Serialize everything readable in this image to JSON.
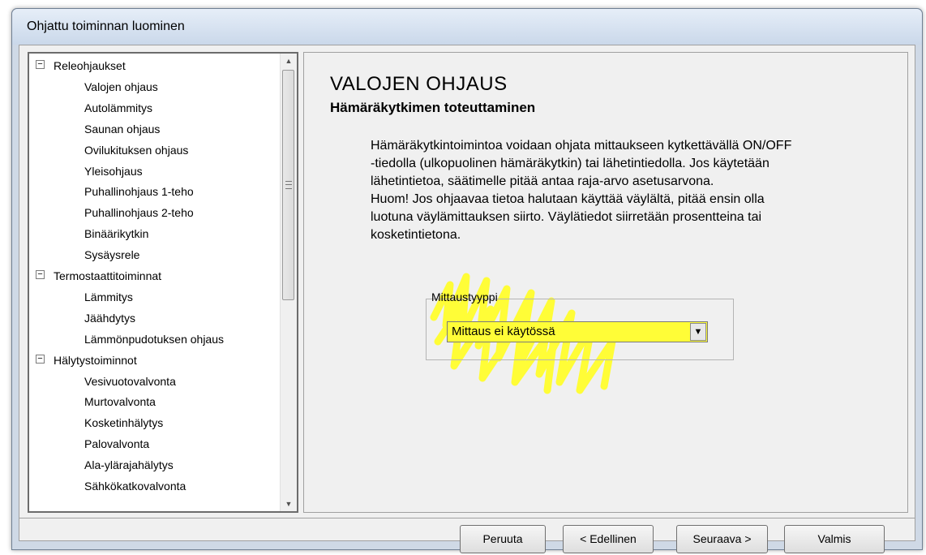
{
  "window": {
    "title": "Ohjattu toiminnan luominen"
  },
  "tree": {
    "groups": [
      {
        "label": "Releohjaukset",
        "items": [
          "Valojen ohjaus",
          "Autolämmitys",
          "Saunan ohjaus",
          "Ovilukituksen ohjaus",
          "Yleisohjaus",
          "Puhallinohjaus 1-teho",
          "Puhallinohjaus 2-teho",
          "Binäärikytkin",
          "Sysäysrele"
        ]
      },
      {
        "label": "Termostaattitoiminnat",
        "items": [
          "Lämmitys",
          "Jäähdytys",
          "Lämmönpudotuksen ohjaus"
        ]
      },
      {
        "label": "Hälytystoiminnot",
        "items": [
          "Vesivuotovalvonta",
          "Murtovalvonta",
          "Kosketinhälytys",
          "Palovalvonta",
          "Ala-ylärajahälytys",
          "Sähkökatkovalvonta"
        ]
      }
    ],
    "expander_symbol": "−"
  },
  "main": {
    "heading": "VALOJEN OHJAUS",
    "subheading": "Hämäräkytkimen toteuttaminen",
    "description_lines": [
      "Hämäräkytkintoimintoa voidaan ohjata mittaukseen kytkettävällä ON/OFF",
      "-tiedolla (ulkopuolinen hämäräkytkin) tai lähetintiedolla. Jos käytetään",
      "lähetintietoa, säätimelle pitää antaa raja-arvo asetusarvona.",
      "Huom! Jos ohjaavaa tietoa halutaan käyttää väylältä, pitää ensin olla",
      "luotuna väylämittauksen siirto. Väylätiedot siirretään prosentteina tai",
      "kosketintietona."
    ],
    "measurement": {
      "label": "Mittaustyyppi",
      "value": "Mittaus ei käytössä"
    }
  },
  "buttons": {
    "cancel": "Peruuta",
    "back": "< Edellinen",
    "next": "Seuraava >",
    "finish": "Valmis"
  },
  "colors": {
    "highlight": "#fffd37",
    "window_frame": "#cfd9e6",
    "dialog_bg": "#f0f0f0"
  }
}
